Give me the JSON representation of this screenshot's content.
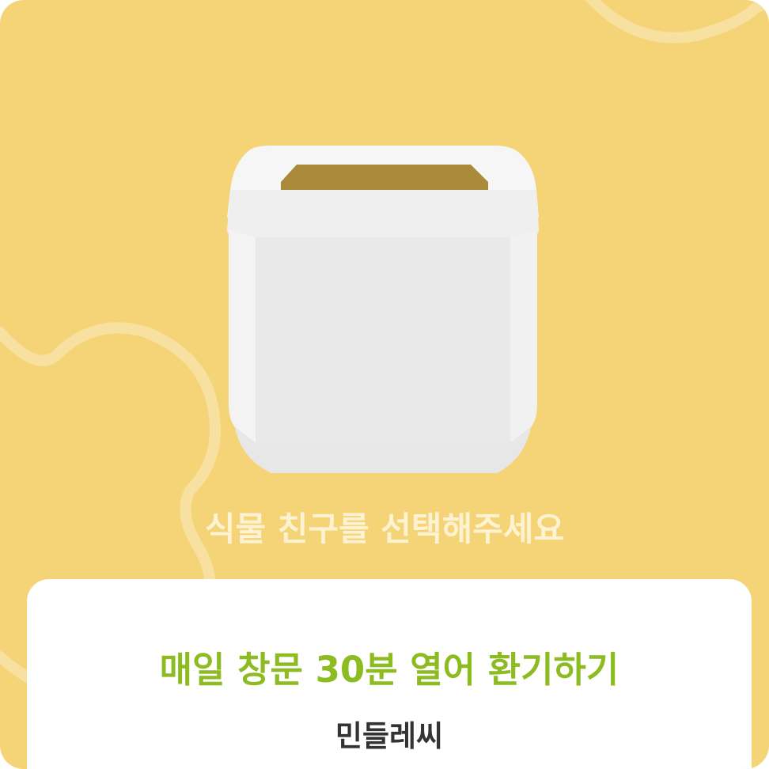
{
  "colors": {
    "background": "#f5d478",
    "prompt_text": "#fdf3d2",
    "mission_text": "#8dbb22",
    "name_text": "#333333",
    "panel": "#ffffff",
    "pot_white": "#eeeeee",
    "soil": "#a98a3a"
  },
  "illustration": {
    "icon": "white-square-pot-icon"
  },
  "prompt": "식물 친구를 선택해주세요",
  "mission_card": {
    "mission": "매일 창문 30분 열어 환기하기",
    "plant_name": "민들레씨"
  }
}
